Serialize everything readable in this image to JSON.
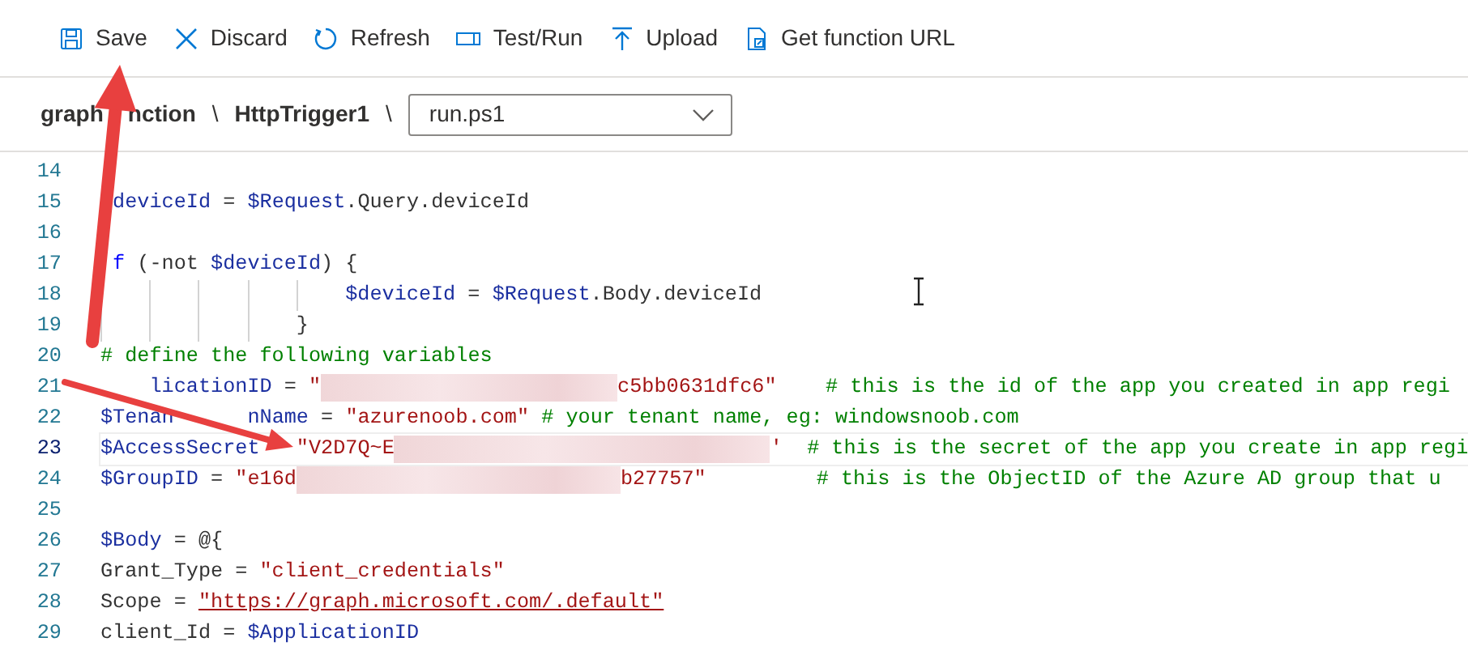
{
  "toolbar": [
    {
      "kind": "save",
      "label": "Save"
    },
    {
      "kind": "discard",
      "label": "Discard"
    },
    {
      "kind": "refresh",
      "label": "Refresh"
    },
    {
      "kind": "test",
      "label": "Test/Run"
    },
    {
      "kind": "upload",
      "label": "Upload"
    },
    {
      "kind": "url",
      "label": "Get function URL"
    }
  ],
  "breadcrumb": {
    "items": [
      {
        "parts": [
          "graph",
          "nction"
        ]
      },
      {
        "parts": [
          "HttpTrigger1"
        ]
      }
    ],
    "separator": "\\",
    "file_select": {
      "value": "run.ps1"
    }
  },
  "editor": {
    "lines": [
      {
        "number": "14",
        "current": false
      },
      {
        "number": "15",
        "current": false,
        "tokens": [
          {
            "kind": "covered"
          },
          {
            "kind": "var",
            "text": "deviceId"
          },
          {
            "kind": "plain",
            "text": " = "
          },
          {
            "kind": "var",
            "text": "$Request"
          },
          {
            "kind": "plain",
            "text": ".Query.deviceId"
          }
        ]
      },
      {
        "number": "16",
        "current": false
      },
      {
        "number": "17",
        "current": false,
        "tokens": [
          {
            "kind": "covered"
          },
          {
            "kind": "keyword",
            "text": "f"
          },
          {
            "kind": "plain",
            "text": " (-not "
          },
          {
            "kind": "var",
            "text": "$deviceId"
          },
          {
            "kind": "plain",
            "text": ") {"
          }
        ]
      },
      {
        "number": "18",
        "current": false,
        "tokens": [
          {
            "kind": "indent"
          },
          {
            "kind": "indent"
          },
          {
            "kind": "indent"
          },
          {
            "kind": "indent"
          },
          {
            "kind": "indent"
          },
          {
            "kind": "var",
            "text": "$deviceId"
          },
          {
            "kind": "plain",
            "text": " = "
          },
          {
            "kind": "var",
            "text": "$Request"
          },
          {
            "kind": "plain",
            "text": ".Body.deviceId"
          }
        ]
      },
      {
        "number": "19",
        "current": false,
        "tokens": [
          {
            "kind": "indent"
          },
          {
            "kind": "indent"
          },
          {
            "kind": "indent"
          },
          {
            "kind": "indent"
          },
          {
            "kind": "plain",
            "text": "}"
          }
        ]
      },
      {
        "number": "20",
        "current": false,
        "tokens": [
          {
            "kind": "comment",
            "text": "# define the following variables"
          }
        ]
      },
      {
        "number": "21",
        "current": false,
        "tokens": [
          {
            "kind": "covered"
          },
          {
            "kind": "var",
            "text": "licationID"
          },
          {
            "kind": "plain",
            "text": " = "
          },
          {
            "kind": "string",
            "text": "\""
          },
          {
            "kind": "redacted"
          },
          {
            "kind": "string",
            "text": "c5bb0631dfc6\""
          },
          {
            "kind": "gap"
          },
          {
            "kind": "comment",
            "text": "# this is the id of the app you created in app regi"
          }
        ]
      },
      {
        "number": "22",
        "current": false,
        "tokens": [
          {
            "kind": "var",
            "text": "$Tenan"
          },
          {
            "kind": "covered"
          },
          {
            "kind": "var",
            "text": "nName"
          },
          {
            "kind": "plain",
            "text": " = "
          },
          {
            "kind": "string",
            "text": "\"azurenoob.com\""
          },
          {
            "kind": "gap"
          },
          {
            "kind": "comment",
            "text": "# your tenant name, eg: windowsnoob.com"
          }
        ]
      },
      {
        "number": "23",
        "current": true,
        "tokens": [
          {
            "kind": "var",
            "text": "$AccessSecret"
          },
          {
            "kind": "covered"
          },
          {
            "kind": "string",
            "text": "\"V2D7Q~E"
          },
          {
            "kind": "redacted"
          },
          {
            "kind": "string",
            "text": "'"
          },
          {
            "kind": "gap"
          },
          {
            "kind": "comment",
            "text": "# this is the secret of the app you create in app regi"
          }
        ]
      },
      {
        "number": "24",
        "current": false,
        "tokens": [
          {
            "kind": "var",
            "text": "$GroupID"
          },
          {
            "kind": "plain",
            "text": " = "
          },
          {
            "kind": "string",
            "text": "\"e16d"
          },
          {
            "kind": "redacted"
          },
          {
            "kind": "string",
            "text": "b27757\""
          },
          {
            "kind": "gap"
          },
          {
            "kind": "comment",
            "text": "# this is the ObjectID of the Azure AD group that u"
          }
        ]
      },
      {
        "number": "25",
        "current": false
      },
      {
        "number": "26",
        "current": false,
        "tokens": [
          {
            "kind": "var",
            "text": "$Body"
          },
          {
            "kind": "plain",
            "text": " = @{"
          }
        ]
      },
      {
        "number": "27",
        "current": false,
        "tokens": [
          {
            "kind": "plain",
            "text": "Grant_Type = "
          },
          {
            "kind": "string",
            "text": "\"client_credentials\""
          }
        ]
      },
      {
        "number": "28",
        "current": false,
        "tokens": [
          {
            "kind": "plain",
            "text": "Scope = "
          },
          {
            "kind": "link",
            "text": "\"https://graph.microsoft.com/.default\""
          }
        ]
      },
      {
        "number": "29",
        "current": false,
        "tokens": [
          {
            "kind": "plain",
            "text": "client_Id = "
          },
          {
            "kind": "var",
            "text": "$ApplicationID"
          }
        ]
      }
    ]
  },
  "annotations": [
    {
      "kind": "arrow"
    },
    {
      "kind": "arrow"
    }
  ]
}
